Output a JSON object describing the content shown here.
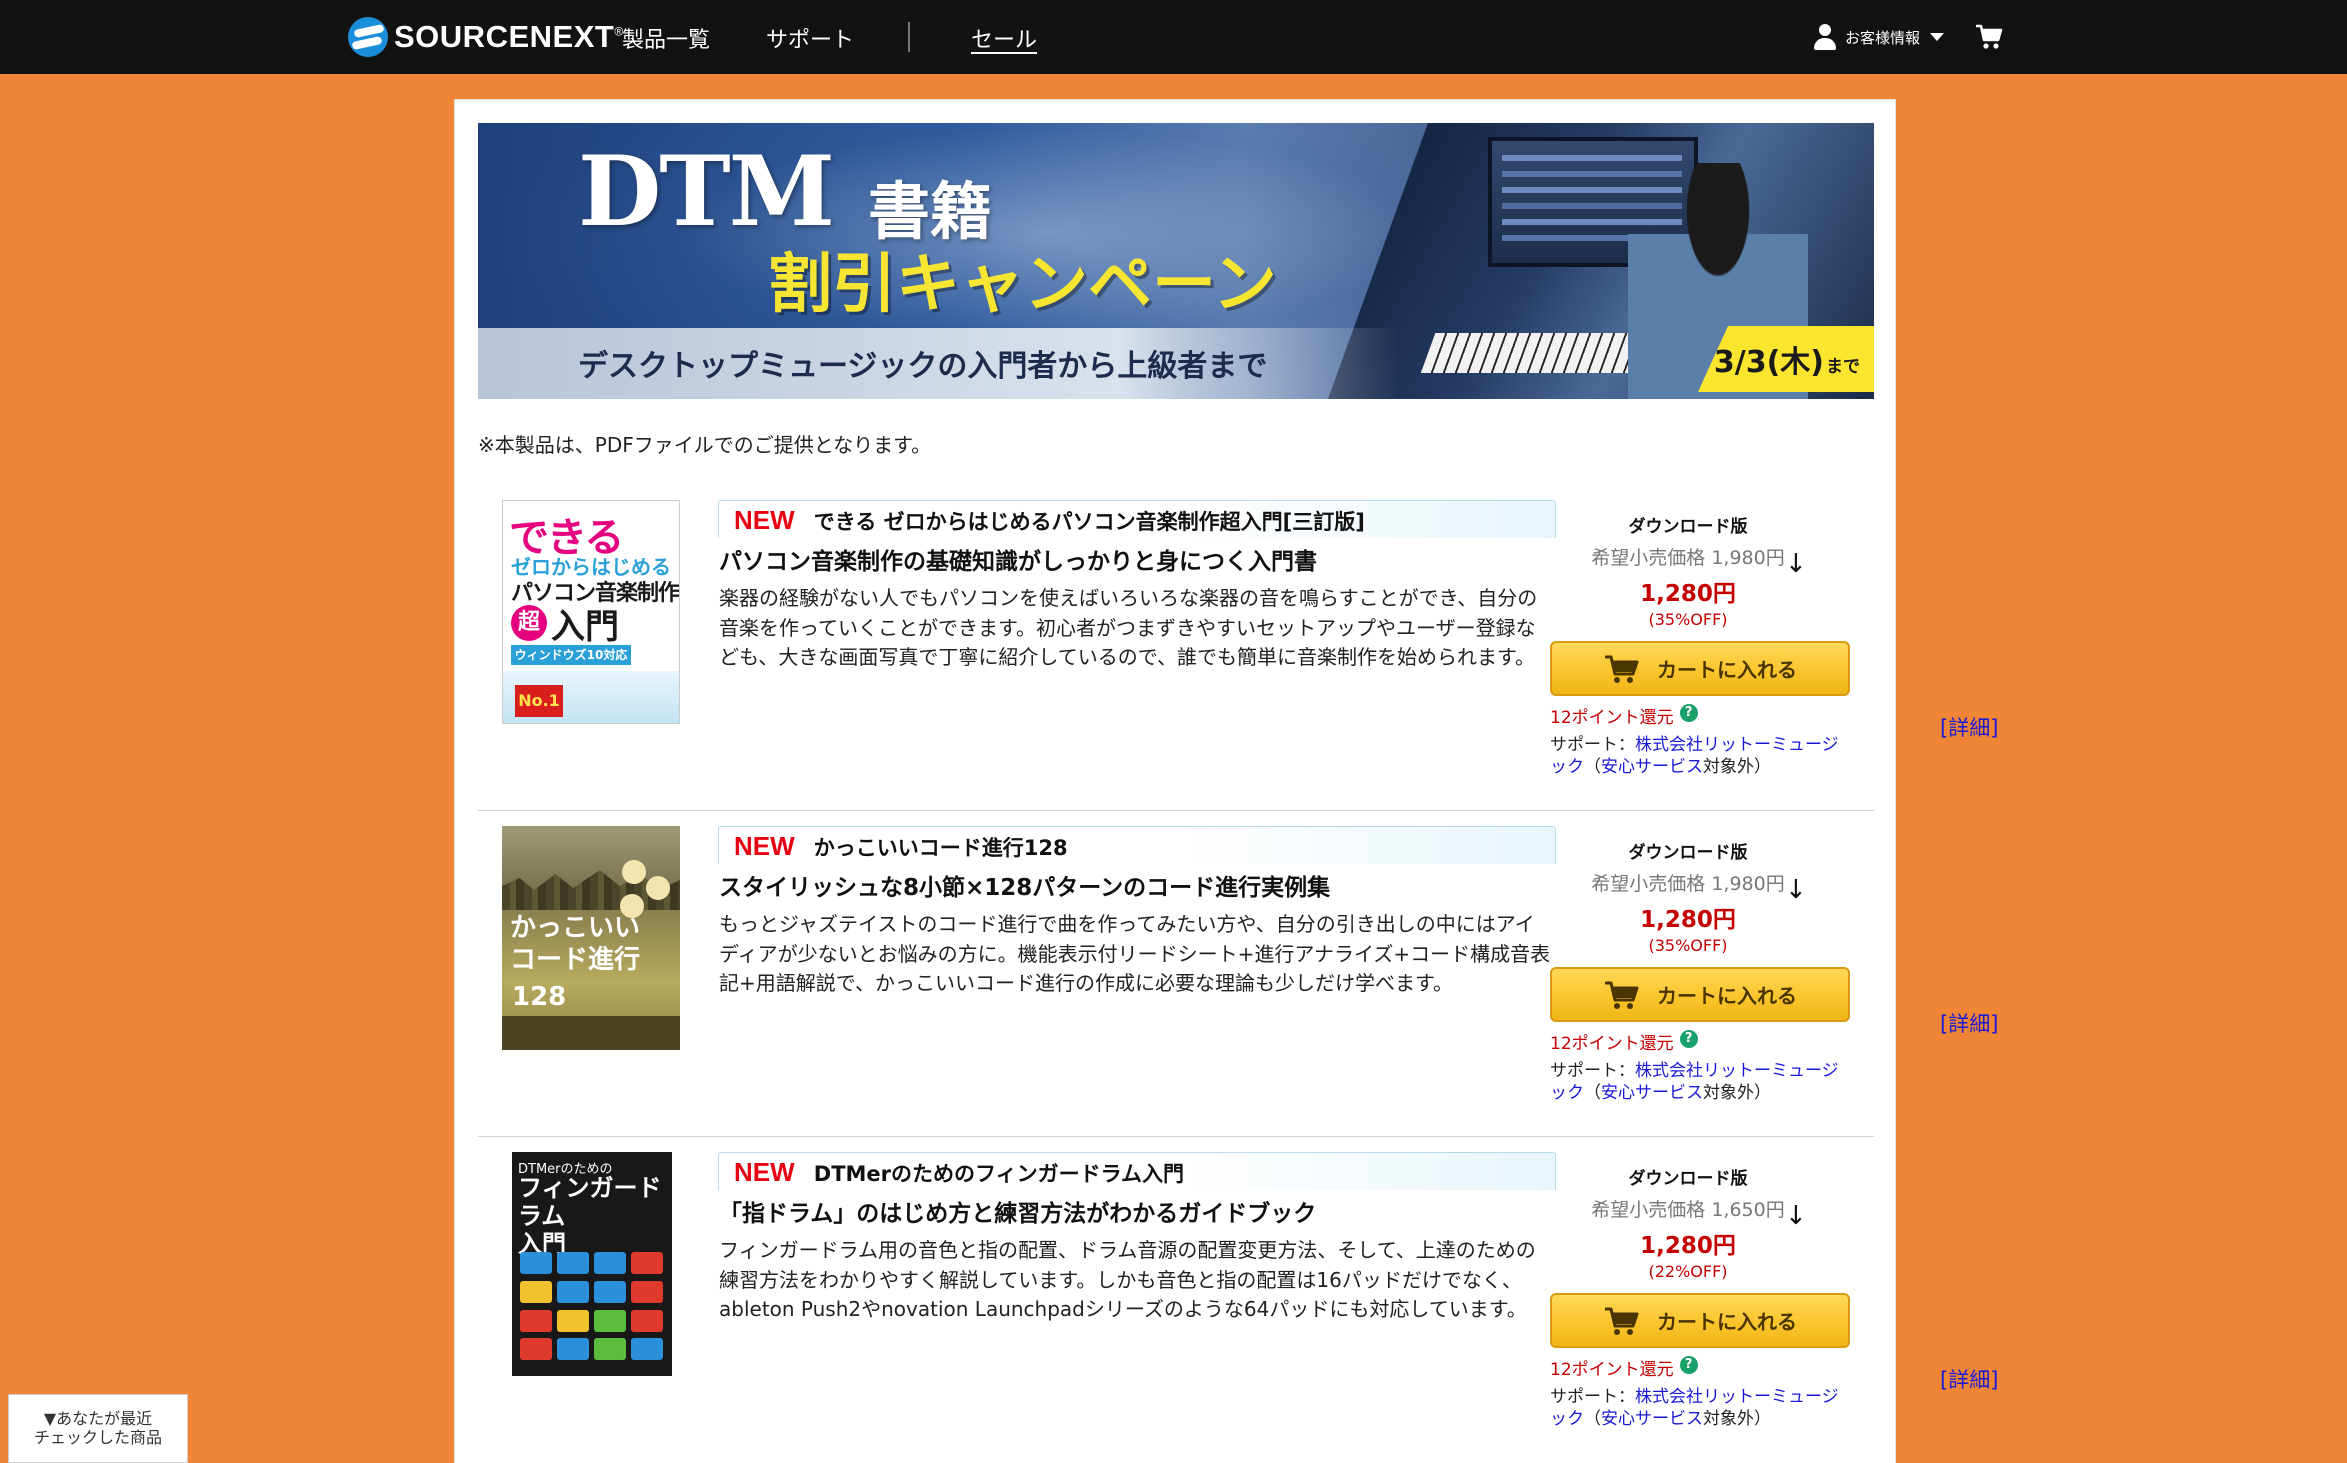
{
  "header": {
    "logo_text": "SOURCENEXT",
    "logo_mark": "®",
    "nav": [
      {
        "label": "製品一覧"
      },
      {
        "label": "サポート"
      },
      {
        "label": "セール"
      }
    ],
    "user_menu_label": "お客様情報",
    "icons": [
      "sourcenext-logo-icon",
      "user-icon",
      "chevron-down-icon",
      "cart-icon"
    ]
  },
  "banner": {
    "title_dtm": "DTM",
    "title_shoseki": "書籍",
    "title_campaign": "割引キャンペーン",
    "subtitle": "デスクトップミュージックの入門者から上級者まで",
    "date_main": "3/3(木)",
    "date_suffix": "まで"
  },
  "notice": "※本製品は、PDFファイルでのご提供となります。",
  "products": [
    {
      "badge": "NEW",
      "name": "できる ゼロからはじめるパソコン音楽制作超入門[三訂版]",
      "catchcopy": "パソコン音楽制作の基礎知識がしっかりと身につく入門書",
      "description": "楽器の経験がない人でもパソコンを使えばいろいろな楽器の音を鳴らすことができ、自分の音楽を作っていくことができます。初心者がつまずきやすいセットアップやユーザー登録なども、大きな画面写真で丁寧に紹介しているので、誰でも簡単に音楽制作を始められます。",
      "detail_link": "[詳細]",
      "edition": "ダウンロード版",
      "list_price": "希望小売価格 1,980円",
      "sale_price": "1,280円",
      "discount": "(35%OFF)",
      "cart_label": "カートに入れる",
      "points": "12ポイント還元",
      "support_prefix": "サポート：",
      "support_company": "株式会社リットーミュージック",
      "support_paren_open": "（",
      "support_service": "安心サービス",
      "support_suffix": "対象外）",
      "cover": {
        "dekiru": "できる",
        "zero": "ゼロからはじめる",
        "pc": "パソコン音楽制作",
        "cho": "超",
        "nyumon": "入門",
        "win": "ウィンドウズ10対応",
        "no1": "No.1"
      }
    },
    {
      "badge": "NEW",
      "name": "かっこいいコード進行128",
      "catchcopy": "スタイリッシュな8小節×128パターンのコード進行実例集",
      "description": "もっとジャズテイストのコード進行で曲を作ってみたい方や、自分の引き出しの中にはアイディアが少ないとお悩みの方に。機能表示付リードシート+進行アナライズ+コード構成音表記+用語解説で、かっこいいコード進行の作成に必要な理論も少しだけ学べます。",
      "detail_link": "[詳細]",
      "edition": "ダウンロード版",
      "list_price": "希望小売価格 1,980円",
      "sale_price": "1,280円",
      "discount": "(35%OFF)",
      "cart_label": "カートに入れる",
      "points": "12ポイント還元",
      "support_prefix": "サポート：",
      "support_company": "株式会社リットーミュージック",
      "support_paren_open": "（",
      "support_service": "安心サービス",
      "support_suffix": "対象外）",
      "cover": {
        "title_line1": "かっこいい",
        "title_line2": "コード進行",
        "num": "128"
      }
    },
    {
      "badge": "NEW",
      "name": "DTMerのためのフィンガードラム入門",
      "catchcopy": "「指ドラム」のはじめ方と練習方法がわかるガイドブック",
      "description": "フィンガードラム用の音色と指の配置、ドラム音源の配置変更方法、そして、上達のための練習方法をわかりやすく解説しています。しかも音色と指の配置は16パッドだけでなく、ableton Push2やnovation Launchpadシリーズのような64パッドにも対応しています。",
      "detail_link": "[詳細]",
      "edition": "ダウンロード版",
      "list_price": "希望小売価格 1,650円",
      "sale_price": "1,280円",
      "discount": "(22%OFF)",
      "cart_label": "カートに入れる",
      "points": "12ポイント還元",
      "support_prefix": "サポート：",
      "support_company": "株式会社リットーミュージック",
      "support_paren_open": "（",
      "support_service": "安心サービス",
      "support_suffix": "対象外）",
      "cover": {
        "top": "DTMerのための",
        "title_line1": "フィンガードラム",
        "title_line2": "入門"
      }
    }
  ],
  "recent": {
    "line1": "▼あなたが最近",
    "line2": "チェックした商品"
  },
  "colors": {
    "page_bg": "#f08535",
    "header_bg": "#121212",
    "accent_red": "#c40000",
    "new_red": "#e60012",
    "link_blue": "#1a1ad6",
    "cart_yellow": "#fbc52d"
  }
}
